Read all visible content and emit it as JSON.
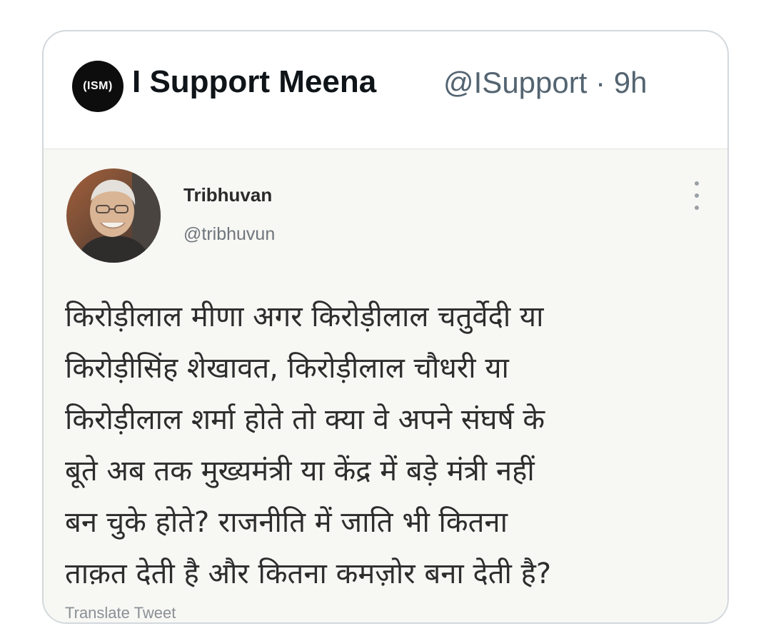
{
  "tweet": {
    "logo_text": "(ISM)",
    "display_name": "I Support Meena",
    "handle_time": "@ISupport · 9h"
  },
  "quoted_tweet": {
    "name": "Tribhuvan",
    "handle": "@tribhuvun",
    "lines": [
      "किरोड़ीलाल मीणा अगर किरोड़ीलाल चतुर्वेदी या",
      "किरोड़ीसिंह शेखावत, किरोड़ीलाल चौधरी या",
      "किरोड़ीलाल शर्मा होते तो क्या वे अपने संघर्ष के",
      "बूते अब तक मुख्यमंत्री या केंद्र में बड़े मंत्री नहीं",
      "बन चुके होते? राजनीति में जाति भी कितना",
      "ताक़त देती है और कितना कमज़ोर बना देती है?"
    ],
    "translate_label": "Translate Tweet",
    "more_icon": "vertical-ellipsis"
  },
  "colors": {
    "name_text": "#0f1419",
    "secondary_text": "#536471",
    "card_border": "#d3d8dc",
    "logo_bg": "#0d0d0d"
  }
}
